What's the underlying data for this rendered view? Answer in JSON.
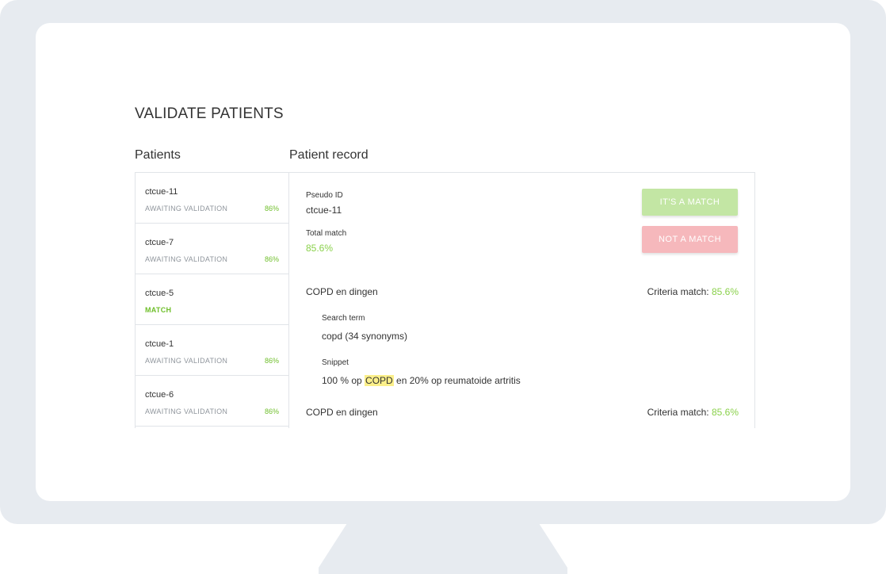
{
  "page": {
    "title": "VALIDATE PATIENTS"
  },
  "patients": {
    "heading": "Patients",
    "items": [
      {
        "id": "ctcue-11",
        "status": "AWAITING VALIDATION",
        "score": "86%"
      },
      {
        "id": "ctcue-7",
        "status": "AWAITING VALIDATION",
        "score": "86%"
      },
      {
        "id": "ctcue-5",
        "status": "MATCH",
        "score": ""
      },
      {
        "id": "ctcue-1",
        "status": "AWAITING VALIDATION",
        "score": "86%"
      },
      {
        "id": "ctcue-6",
        "status": "AWAITING VALIDATION",
        "score": "86%"
      }
    ]
  },
  "record": {
    "heading": "Patient record",
    "pseudo_id_label": "Pseudo ID",
    "pseudo_id_value": "ctcue-11",
    "total_match_label": "Total match",
    "total_match_value": "85.6%",
    "match_button": "IT'S A MATCH",
    "no_match_button": "NOT A MATCH",
    "criteria": [
      {
        "title": "COPD en dingen",
        "match_label": "Criteria match:",
        "match_value": "85.6%",
        "search_term_label": "Search term",
        "search_term_value": "copd (34 synonyms)",
        "snippet_label": "Snippet",
        "snippet_before": "100 % op ",
        "snippet_highlight": "COPD",
        "snippet_after": " en 20% op reumatoide artritis"
      },
      {
        "title": "COPD en dingen",
        "match_label": "Criteria match:",
        "match_value": "85.6%"
      }
    ]
  },
  "colors": {
    "accent_green": "#8ad14b",
    "match_button": "#c3e6a4",
    "no_match_button": "#f6b8bc",
    "highlight": "#fbef8a",
    "frame": "#e7ebf0"
  }
}
